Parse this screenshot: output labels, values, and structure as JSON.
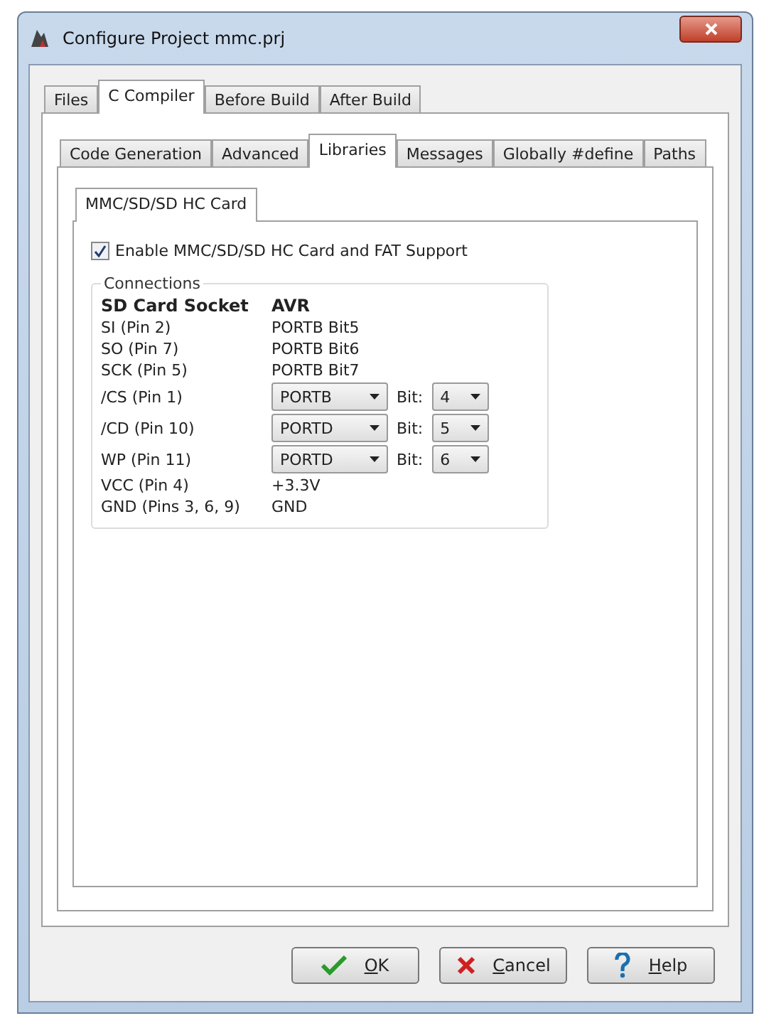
{
  "window": {
    "title": "Configure Project mmc.prj"
  },
  "tabs": [
    {
      "label": "Files",
      "selected": false
    },
    {
      "label": "C Compiler",
      "selected": true
    },
    {
      "label": "Before Build",
      "selected": false
    },
    {
      "label": "After Build",
      "selected": false
    }
  ],
  "subtabs": [
    {
      "label": "Code Generation",
      "selected": false
    },
    {
      "label": "Advanced",
      "selected": false
    },
    {
      "label": "Libraries",
      "selected": true
    },
    {
      "label": "Messages",
      "selected": false
    },
    {
      "label": "Globally #define",
      "selected": false
    },
    {
      "label": "Paths",
      "selected": false
    }
  ],
  "library_tabs": [
    {
      "label": "MMC/SD/SD HC Card",
      "selected": true
    }
  ],
  "enable_option": {
    "label": "Enable MMC/SD/SD HC Card and FAT Support",
    "checked": true
  },
  "connections": {
    "title": "Connections",
    "header": [
      "SD Card Socket",
      "AVR"
    ],
    "rows": [
      {
        "kind": "text",
        "pin": "SI (Pin 2)",
        "value": "PORTB Bit5"
      },
      {
        "kind": "text",
        "pin": "SO (Pin 7)",
        "value": "PORTB Bit6"
      },
      {
        "kind": "text",
        "pin": "SCK (Pin 5)",
        "value": "PORTB Bit7"
      },
      {
        "kind": "select",
        "pin": "/CS (Pin 1)",
        "port": "PORTB",
        "bit_label": "Bit:",
        "bit": "4"
      },
      {
        "kind": "select",
        "pin": "/CD (Pin 10)",
        "port": "PORTD",
        "bit_label": "Bit:",
        "bit": "5"
      },
      {
        "kind": "select",
        "pin": "WP (Pin 11)",
        "port": "PORTD",
        "bit_label": "Bit:",
        "bit": "6"
      },
      {
        "kind": "text",
        "pin": "VCC (Pin 4)",
        "value": "+3.3V"
      },
      {
        "kind": "text",
        "pin": "GND (Pins 3, 6, 9)",
        "value": "GND"
      }
    ]
  },
  "buttons": [
    {
      "kind": "ok",
      "label": "OK"
    },
    {
      "kind": "cancel",
      "label": "Cancel"
    },
    {
      "kind": "help",
      "label": "Help"
    }
  ]
}
